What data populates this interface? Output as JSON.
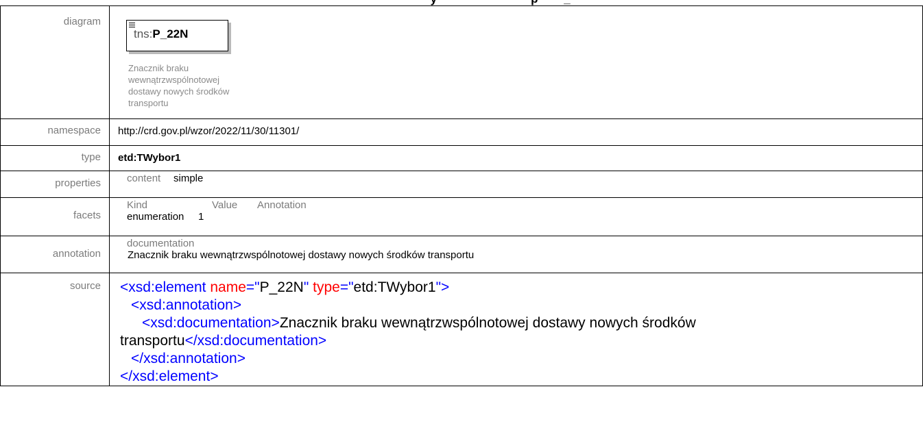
{
  "header": {
    "title_fragment": "                        y                             p        _"
  },
  "rows": {
    "diagram": {
      "label": "diagram"
    },
    "namespace": {
      "label": "namespace",
      "value": "http://crd.gov.pl/wzor/2022/11/30/11301/"
    },
    "type": {
      "label": "type",
      "value": "etd:TWybor1"
    },
    "properties": {
      "label": "properties",
      "key": "content",
      "value": "simple"
    },
    "facets": {
      "label": "facets",
      "headers": [
        "Kind",
        "Value",
        "Annotation"
      ],
      "row": {
        "kind": "enumeration",
        "value": "1"
      }
    },
    "annotation": {
      "label": "annotation",
      "key": "documentation",
      "value": "Znacznik braku wewnątrzwspólnotowej dostawy nowych środków transportu"
    },
    "source": {
      "label": "source"
    }
  },
  "diagram": {
    "prefix": "tns:",
    "name": "P_22N",
    "doc_lines": [
      "Znacznik braku",
      "wewnątrzwspólnotowej",
      "dostawy nowych środków",
      "transportu"
    ]
  },
  "source": {
    "open_tag": "<xsd:element",
    "attr_name": "name",
    "eq1": "=\"",
    "name_val": "P_22N",
    "q1": "\"",
    "attr_type": "type",
    "eq2": "=\"",
    "type_val": "etd:TWybor1",
    "q2": "\"",
    "close1": ">",
    "ann_open": "<xsd:annotation>",
    "doc_open": "<xsd:documentation>",
    "doc_text_1": "Znacznik braku wewnątrzwspólnotowej dostawy nowych środków",
    "doc_text_2": "transportu",
    "doc_close": "</xsd:documentation>",
    "ann_close": "</xsd:annotation>",
    "el_close": "</xsd:element>"
  }
}
